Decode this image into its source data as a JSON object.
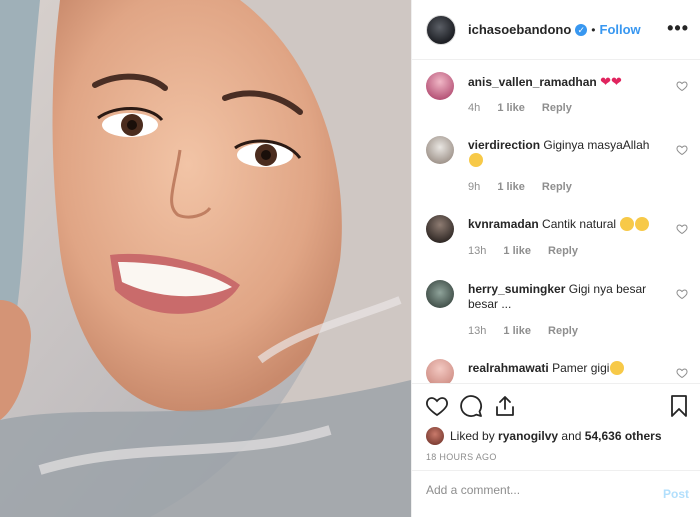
{
  "header": {
    "username": "ichasoebandono",
    "verified_mark": "✓",
    "separator": "•",
    "follow_label": "Follow",
    "more_label": "•••"
  },
  "comments": [
    {
      "username": "anis_vallen_ramadhan",
      "text": "",
      "emoji": "heart-emoji x2",
      "time": "4h",
      "likes": "1 like",
      "reply": "Reply"
    },
    {
      "username": "vierdirection",
      "text": "Giginya masyaAllah",
      "emoji": "smile-emoji",
      "time": "9h",
      "likes": "1 like",
      "reply": "Reply"
    },
    {
      "username": "kvnramadan",
      "text": "Cantik natural",
      "emoji": "blush-emoji x2",
      "time": "13h",
      "likes": "1 like",
      "reply": "Reply"
    },
    {
      "username": "herry_sumingker",
      "text": "Gigi nya besar besar ...",
      "time": "13h",
      "likes": "1 like",
      "reply": "Reply"
    },
    {
      "username": "realrahmawati",
      "text": "Pamer gigi",
      "emoji": "laugh-emoji"
    }
  ],
  "likes": {
    "prefix": "Liked by",
    "user": "ryanogilvy",
    "middle": "and",
    "others": "54,636 others"
  },
  "timestamp": "18 HOURS AGO",
  "add_comment": {
    "placeholder": "Add a comment...",
    "post_label": "Post"
  },
  "colors": {
    "accent": "#3897f0",
    "post_disabled": "#b2dffc",
    "meta": "#8e8e8e",
    "text": "#262626"
  }
}
